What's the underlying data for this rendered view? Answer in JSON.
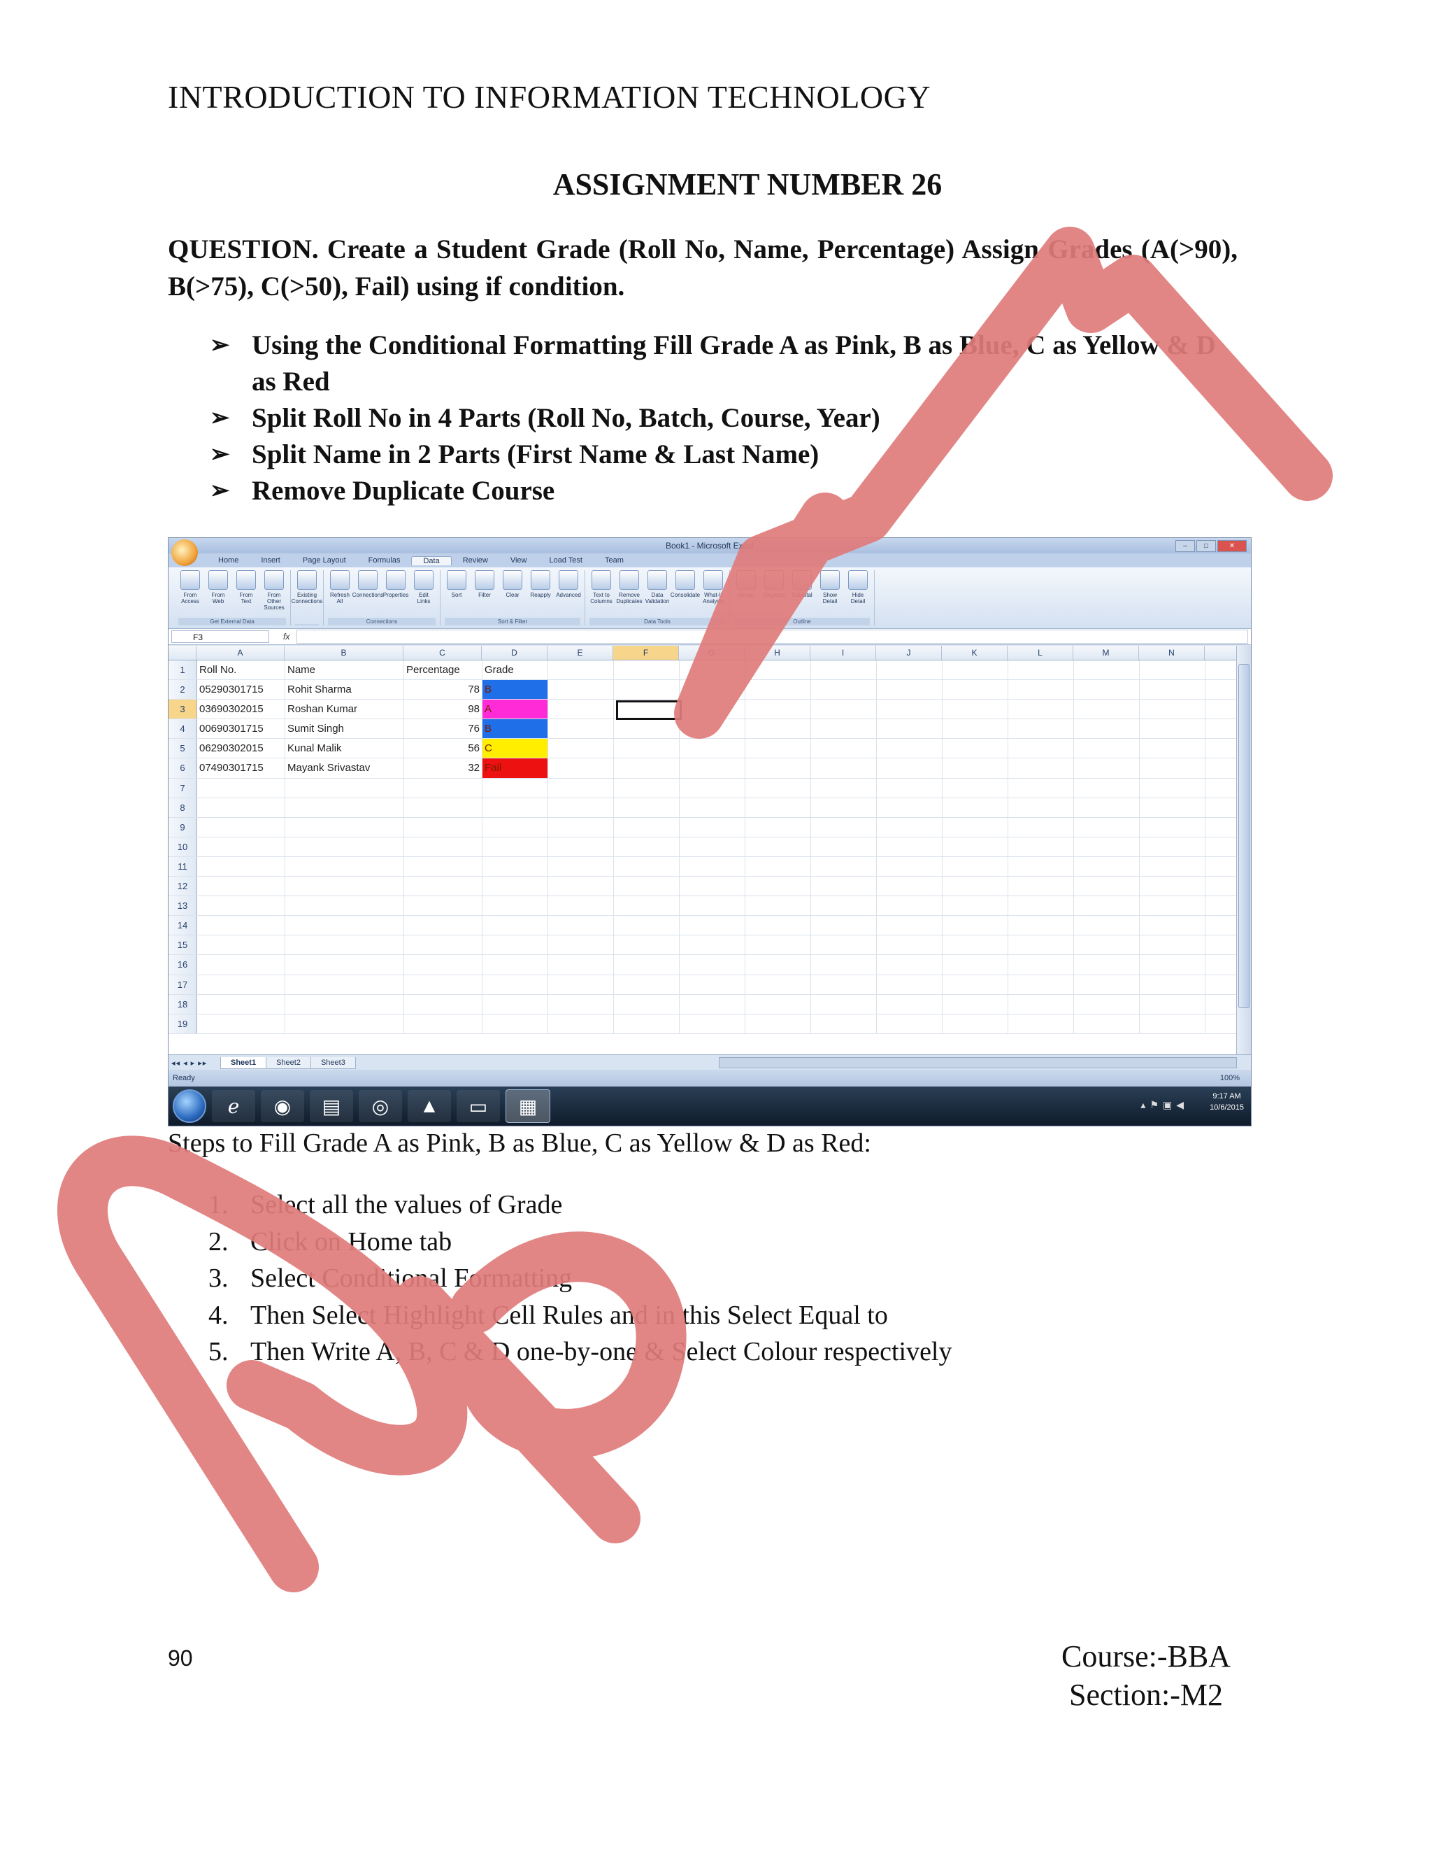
{
  "header": "INTRODUCTION TO INFORMATION TECHNOLOGY",
  "title": "ASSIGNMENT NUMBER 26",
  "question": "QUESTION.  Create a Student Grade (Roll No, Name, Percentage) Assign Grades (A(>90), B(>75), C(>50), Fail) using if condition.",
  "bullets": [
    "Using the Conditional  Formatting  Fill Grade A as Pink, B as Blue, C as Yellow & D as Red",
    "Split Roll No in 4 Parts (Roll No, Batch, Course, Year)",
    "Split Name in 2 Parts (First Name & Last Name)",
    "Remove Duplicate Course"
  ],
  "excel": {
    "window_title": "Book1 - Microsoft Excel",
    "ribbon_tabs": [
      "Home",
      "Insert",
      "Page Layout",
      "Formulas",
      "Data",
      "Review",
      "View",
      "Load Test",
      "Team"
    ],
    "active_tab": "Data",
    "ribbon_groups": [
      {
        "name": "Get External Data",
        "buttons": [
          "From Access",
          "From Web",
          "From Text",
          "From Other Sources"
        ]
      },
      {
        "name": "",
        "buttons": [
          "Existing Connections"
        ]
      },
      {
        "name": "Connections",
        "buttons": [
          "Refresh All",
          "Connections",
          "Properties",
          "Edit Links"
        ]
      },
      {
        "name": "Sort & Filter",
        "buttons": [
          "Sort",
          "Filter",
          "Clear",
          "Reapply",
          "Advanced"
        ]
      },
      {
        "name": "Data Tools",
        "buttons": [
          "Text to Columns",
          "Remove Duplicates",
          "Data Validation",
          "Consolidate",
          "What-If Analysis"
        ]
      },
      {
        "name": "Outline",
        "buttons": [
          "Group",
          "Ungroup",
          "Subtotal",
          "Show Detail",
          "Hide Detail"
        ]
      }
    ],
    "name_box": "F3",
    "fx_label": "fx",
    "columns": [
      "A",
      "B",
      "C",
      "D",
      "E",
      "F",
      "G",
      "H",
      "I",
      "J",
      "K",
      "L",
      "M",
      "N"
    ],
    "selected_column": "F",
    "selected_row": "3",
    "rows": [
      {
        "n": "1",
        "roll": "Roll No.",
        "name": "Name",
        "pct": "Percentage",
        "grade": "Grade",
        "fill": ""
      },
      {
        "n": "2",
        "roll": "05290301715",
        "name": "Rohit Sharma",
        "pct": "78",
        "grade": "B",
        "fill": "#1e6fe8"
      },
      {
        "n": "3",
        "roll": "03690302015",
        "name": "Roshan Kumar",
        "pct": "98",
        "grade": "A",
        "fill": "#ff2bd6"
      },
      {
        "n": "4",
        "roll": "00690301715",
        "name": "Sumit Singh",
        "pct": "76",
        "grade": "B",
        "fill": "#1e6fe8"
      },
      {
        "n": "5",
        "roll": "06290302015",
        "name": "Kunal Malik",
        "pct": "56",
        "grade": "C",
        "fill": "#ffee00"
      },
      {
        "n": "6",
        "roll": "07490301715",
        "name": "Mayank Srivastav",
        "pct": "32",
        "grade": "Fail",
        "fill": "#ee1111"
      },
      {
        "n": "7"
      },
      {
        "n": "8"
      },
      {
        "n": "9"
      },
      {
        "n": "10"
      },
      {
        "n": "11"
      },
      {
        "n": "12"
      },
      {
        "n": "13"
      },
      {
        "n": "14"
      },
      {
        "n": "15"
      },
      {
        "n": "16"
      },
      {
        "n": "17"
      },
      {
        "n": "18"
      },
      {
        "n": "19"
      }
    ],
    "sheet_tabs": [
      "Sheet1",
      "Sheet2",
      "Sheet3"
    ],
    "status": "Ready",
    "zoom": "100%",
    "clock_time": "9:17 AM",
    "clock_date": "10/6/2015"
  },
  "steps_heading": "Steps to Fill Grade A as Pink, B as Blue, C as Yellow & D as Red:",
  "steps": [
    {
      "n": "1.",
      "text": "Select all the values of Grade"
    },
    {
      "n": "2.",
      "text": "Click on Home tab"
    },
    {
      "n": "3.",
      "text": "Select Conditional Formatting"
    },
    {
      "n": "4.",
      "text": "Then Select Highlight Cell Rules and in this Select Equal to"
    },
    {
      "n": "5.",
      "text": "Then Write A, B, C & D one-by-one & Select Colour respectively"
    }
  ],
  "page_number": "90",
  "course": "Course:-BBA",
  "section": "Section:-M2",
  "watermark_color": "#e07b7b"
}
